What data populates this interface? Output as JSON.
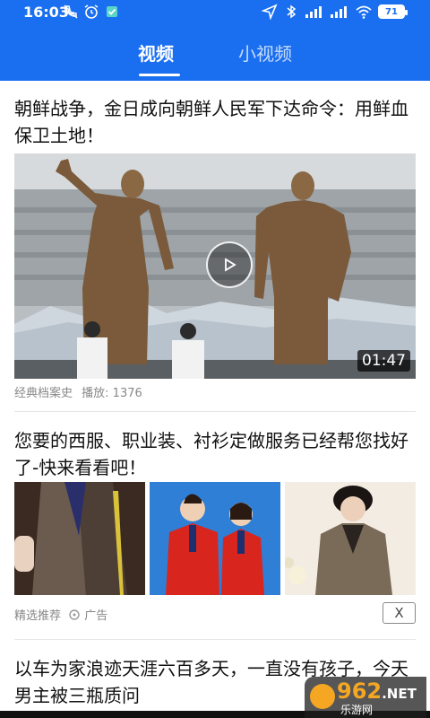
{
  "status_bar": {
    "time": "16:03",
    "battery": "71"
  },
  "tabs": [
    {
      "label": "视频",
      "active": true
    },
    {
      "label": "小视频",
      "active": false
    }
  ],
  "articles": [
    {
      "title": "朝鲜战争，金日成向朝鲜人民军下达命令：用鲜血保卫土地！",
      "source": "经典档案史",
      "plays": "播放: 1376",
      "duration": "01:47"
    },
    {
      "title": "您要的西服、职业装、衬衫定做服务已经帮您找好了-快来看看吧！",
      "source": "精选推荐",
      "ad_label": "广告",
      "close_label": "X"
    },
    {
      "title": "以车为家浪迹天涯六百多天，一直没有孩子，今天男主被三瓶质问"
    }
  ],
  "watermark": {
    "brand": "962",
    "tld": ".NET",
    "sub": "乐游网"
  },
  "colors": {
    "header_blue": "#1a6ff0",
    "watermark_orange": "#f5a623"
  }
}
